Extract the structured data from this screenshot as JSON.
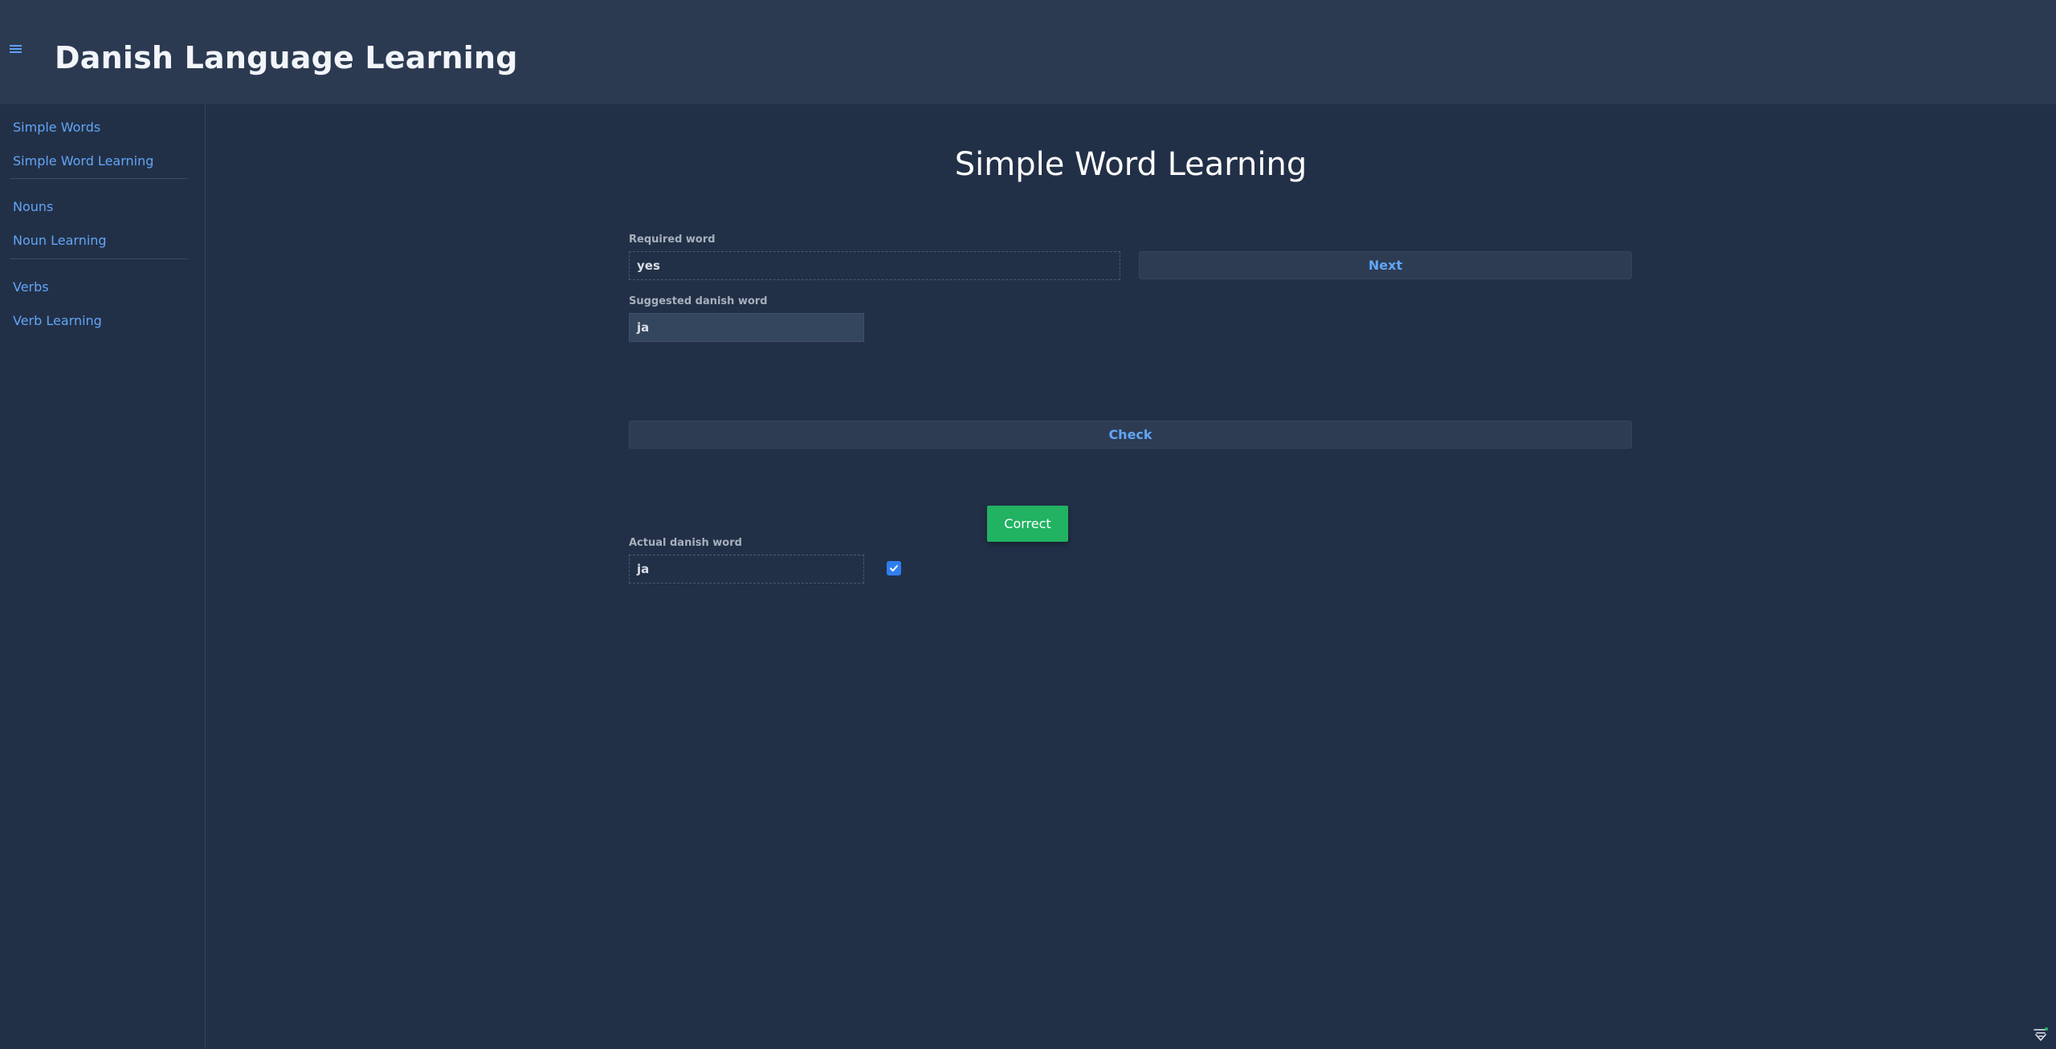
{
  "header": {
    "title": "Danish Language Learning",
    "menu_icon": "hamburger-menu-icon"
  },
  "sidebar": {
    "groups": [
      {
        "items": [
          {
            "label": "Simple Words"
          },
          {
            "label": "Simple Word Learning"
          }
        ]
      },
      {
        "items": [
          {
            "label": "Nouns"
          },
          {
            "label": "Noun Learning"
          }
        ]
      },
      {
        "items": [
          {
            "label": "Verbs"
          },
          {
            "label": "Verb Learning"
          }
        ]
      }
    ]
  },
  "main": {
    "title": "Simple Word Learning",
    "required_word": {
      "label": "Required word",
      "value": "yes"
    },
    "next_button": "Next",
    "suggested_word": {
      "label": "Suggested danish word",
      "value": "ja"
    },
    "check_button": "Check",
    "result_badge": "Correct",
    "actual_word": {
      "label": "Actual danish word",
      "value": "ja",
      "checked": true
    }
  },
  "colors": {
    "background": "#223047",
    "header": "#2b3a51",
    "link": "#62a5f6",
    "success": "#21b262",
    "checkbox": "#2f7ef0"
  }
}
